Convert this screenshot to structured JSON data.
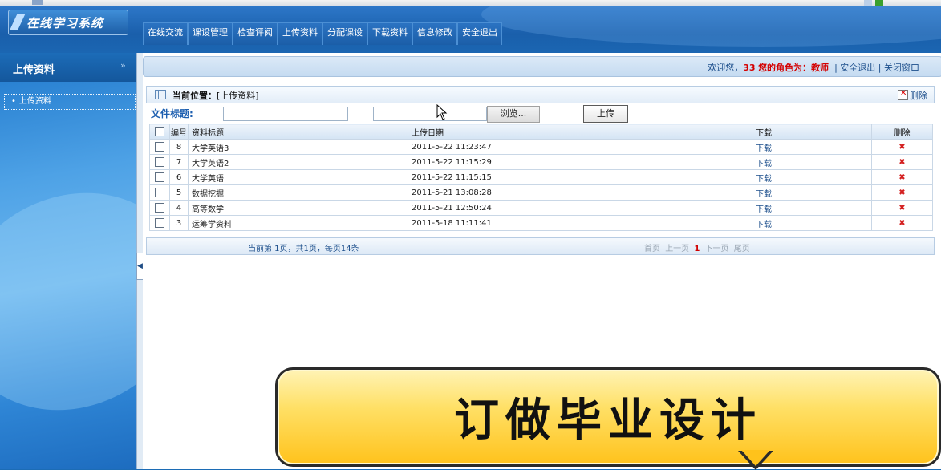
{
  "app": {
    "logo_text": "在线学习系统"
  },
  "nav": [
    {
      "label": "在线交流"
    },
    {
      "label": "课设管理"
    },
    {
      "label": "检查评阅"
    },
    {
      "label": "上传资料"
    },
    {
      "label": "分配课设"
    },
    {
      "label": "下载资料"
    },
    {
      "label": "信息修改"
    },
    {
      "label": "安全退出"
    }
  ],
  "sidebar": {
    "title": "上传资料",
    "chevron": "»",
    "items": [
      {
        "bullet": "•",
        "label": "上传资料"
      }
    ],
    "collapse_glyph": "◀"
  },
  "welcome": {
    "prefix": "欢迎您，",
    "user": "33",
    "role_label": "您的角色为：",
    "role": "教师",
    "logout": "安全退出",
    "sep": "|",
    "close": "关闭窗口"
  },
  "breadcrumb": {
    "label": "当前位置：",
    "path": "[上传资料]",
    "delete": "删除"
  },
  "upload": {
    "title_label": "文件标题:",
    "title_value": "",
    "file_value": "",
    "browse": "浏览...",
    "submit": "上传"
  },
  "table": {
    "headers": {
      "id": "编号",
      "title": "资料标题",
      "date": "上传日期",
      "download": "下载",
      "delete": "删除"
    },
    "rows": [
      {
        "id": "8",
        "title": "大学英语3",
        "date": "2011-5-22 11:23:47",
        "download": "下载",
        "delete": "✖"
      },
      {
        "id": "7",
        "title": "大学英语2",
        "date": "2011-5-22 11:15:29",
        "download": "下载",
        "delete": "✖"
      },
      {
        "id": "6",
        "title": "大学英语",
        "date": "2011-5-22 11:15:15",
        "download": "下载",
        "delete": "✖"
      },
      {
        "id": "5",
        "title": "数据挖掘",
        "date": "2011-5-21 13:08:28",
        "download": "下载",
        "delete": "✖"
      },
      {
        "id": "4",
        "title": "高等数学",
        "date": "2011-5-21 12:50:24",
        "download": "下载",
        "delete": "✖"
      },
      {
        "id": "3",
        "title": "运筹学资料",
        "date": "2011-5-18 11:11:41",
        "download": "下载",
        "delete": "✖"
      }
    ]
  },
  "pager": {
    "info": "当前第 1页，共1页，每页14条",
    "first": "首页",
    "prev": "上一页",
    "current": "1",
    "next": "下一页",
    "last": "尾页"
  },
  "banner": {
    "text": "订做毕业设计"
  },
  "colors": {
    "accent": "#1b66b2",
    "highlight": "#d40000",
    "banner": "#ffc21b"
  }
}
